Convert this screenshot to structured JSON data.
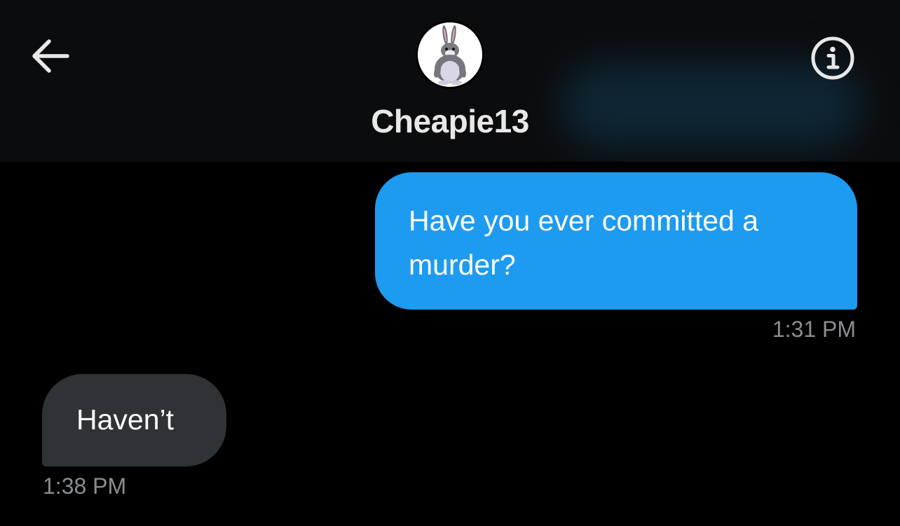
{
  "header": {
    "contact_name": "Cheapie13",
    "back_icon": "arrow-left-icon",
    "info_icon": "info-circle-icon",
    "avatar_icon": "rabbit-avatar-icon"
  },
  "messages": [
    {
      "direction": "outgoing",
      "text": "Have you ever committed a murder?",
      "time": "1:31 PM"
    },
    {
      "direction": "incoming",
      "text": "Haven’t",
      "time": "1:38 PM"
    }
  ],
  "colors": {
    "background": "#000000",
    "header_background": "#0b0c0d",
    "outgoing_bubble": "#1d9bf0",
    "incoming_bubble": "#2f3336",
    "timestamp": "#8a8d91"
  }
}
